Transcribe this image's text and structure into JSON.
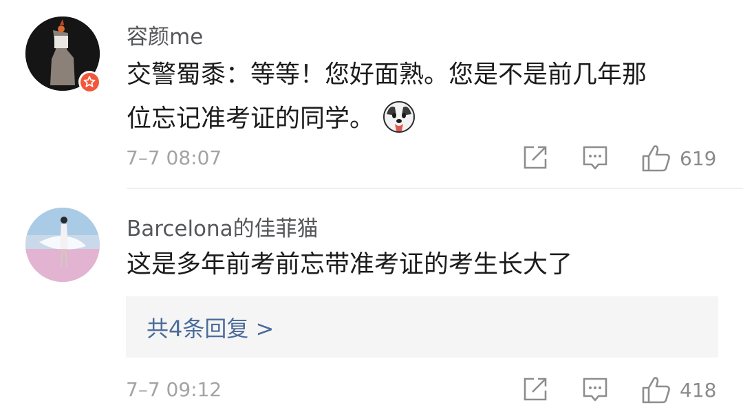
{
  "comments": [
    {
      "username": "容颜me",
      "verified": true,
      "content_lines": [
        "交警蜀黍：等等！您好面熟。您是不是前几年那",
        "位忘记准考证的同学。"
      ],
      "emoji": "husky-emoji",
      "timestamp": "7–7 08:07",
      "likes": "619"
    },
    {
      "username": "Barcelona的佳菲猫",
      "verified": false,
      "content_lines": [
        "这是多年前考前忘带准考证的考生长大了"
      ],
      "replies_label": "共4条回复 >",
      "timestamp": "7–7 09:12",
      "likes": "418"
    }
  ],
  "colors": {
    "username": "#56575a",
    "content": "#1c1c1c",
    "timestamp": "#a3a3a3",
    "reply_link": "#4b6c9a",
    "verified_badge": "#f2573b"
  }
}
